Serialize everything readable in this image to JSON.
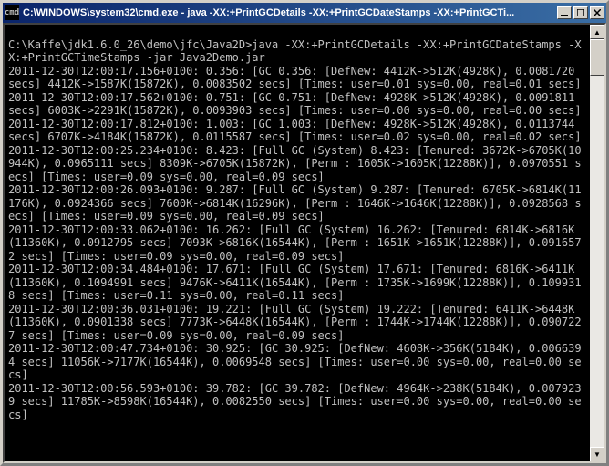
{
  "window": {
    "icon_label": "cmd",
    "title": "C:\\WINDOWS\\system32\\cmd.exe - java  -XX:+PrintGCDetails  -XX:+PrintGCDateStamps  -XX:+PrintGCTi..."
  },
  "terminal": {
    "lines": [
      "",
      "C:\\Kaffe\\jdk1.6.0_26\\demo\\jfc\\Java2D>java -XX:+PrintGCDetails -XX:+PrintGCDateStamps -XX:+PrintGCTimeStamps -jar Java2Demo.jar",
      "2011-12-30T12:00:17.156+0100: 0.356: [GC 0.356: [DefNew: 4412K->512K(4928K), 0.0081720 secs] 4412K->1587K(15872K), 0.0083502 secs] [Times: user=0.01 sys=0.00, real=0.01 secs]",
      "2011-12-30T12:00:17.562+0100: 0.751: [GC 0.751: [DefNew: 4928K->512K(4928K), 0.0091811 secs] 6003K->2291K(15872K), 0.0093903 secs] [Times: user=0.00 sys=0.00, real=0.00 secs]",
      "2011-12-30T12:00:17.812+0100: 1.003: [GC 1.003: [DefNew: 4928K->512K(4928K), 0.0113744 secs] 6707K->4184K(15872K), 0.0115587 secs] [Times: user=0.02 sys=0.00, real=0.02 secs]",
      "2011-12-30T12:00:25.234+0100: 8.423: [Full GC (System) 8.423: [Tenured: 3672K->6705K(10944K), 0.0965111 secs] 8309K->6705K(15872K), [Perm : 1605K->1605K(12288K)], 0.0970551 secs] [Times: user=0.09 sys=0.00, real=0.09 secs]",
      "2011-12-30T12:00:26.093+0100: 9.287: [Full GC (System) 9.287: [Tenured: 6705K->6814K(11176K), 0.0924366 secs] 7600K->6814K(16296K), [Perm : 1646K->1646K(12288K)], 0.0928568 secs] [Times: user=0.09 sys=0.00, real=0.09 secs]",
      "2011-12-30T12:00:33.062+0100: 16.262: [Full GC (System) 16.262: [Tenured: 6814K->6816K(11360K), 0.0912795 secs] 7093K->6816K(16544K), [Perm : 1651K->1651K(12288K)], 0.0916572 secs] [Times: user=0.09 sys=0.00, real=0.09 secs]",
      "2011-12-30T12:00:34.484+0100: 17.671: [Full GC (System) 17.671: [Tenured: 6816K->6411K(11360K), 0.1094991 secs] 9476K->6411K(16544K), [Perm : 1735K->1699K(12288K)], 0.1099318 secs] [Times: user=0.11 sys=0.00, real=0.11 secs]",
      "2011-12-30T12:00:36.031+0100: 19.221: [Full GC (System) 19.222: [Tenured: 6411K->6448K(11360K), 0.0901338 secs] 7773K->6448K(16544K), [Perm : 1744K->1744K(12288K)], 0.0907227 secs] [Times: user=0.09 sys=0.00, real=0.09 secs]",
      "2011-12-30T12:00:47.734+0100: 30.925: [GC 30.925: [DefNew: 4608K->356K(5184K), 0.0066394 secs] 11056K->7177K(16544K), 0.0069548 secs] [Times: user=0.00 sys=0.00, real=0.00 secs]",
      "2011-12-30T12:00:56.593+0100: 39.782: [GC 39.782: [DefNew: 4964K->238K(5184K), 0.0079239 secs] 11785K->8598K(16544K), 0.0082550 secs] [Times: user=0.00 sys=0.00, real=0.00 secs]"
    ]
  },
  "scrollbar": {
    "up_glyph": "▲",
    "down_glyph": "▼"
  }
}
